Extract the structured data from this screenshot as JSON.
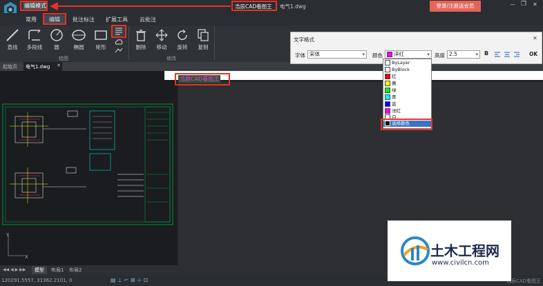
{
  "titlebar": {
    "mode_label": "编辑模式",
    "app_name": "浩辰CAD看图王",
    "doc_title": "电气1.dwg",
    "register_button": "登录/注册送会员",
    "minimize": "—",
    "restore": "❐",
    "close": "✕"
  },
  "menu_tabs": [
    "常用",
    "编辑",
    "批注标注",
    "扩展工具",
    "云批注"
  ],
  "ribbon": {
    "draw_tools": [
      "直线",
      "多段线",
      "圆",
      "椭圆",
      "矩形"
    ],
    "draw_group": "绘图",
    "modify_tools": [
      "删除",
      "移动",
      "旋转",
      "复制"
    ],
    "modify_group": "修改"
  },
  "doc_tabs": [
    "起始页",
    "电气1.dwg"
  ],
  "canvas_text": "浩辰CAD看图王",
  "text_format": {
    "title": "文字格式",
    "font_label": "字体",
    "font_value": "宋体",
    "color_label": "颜色",
    "color_value": "洋红",
    "height_label": "高度",
    "height_value": "2.5",
    "bold": "B",
    "ok": "OK"
  },
  "color_options": [
    {
      "label": "ByLayer",
      "color": "#ffffff"
    },
    {
      "label": "ByBlock",
      "color": "#ffffff"
    },
    {
      "label": "红",
      "color": "#ff0000"
    },
    {
      "label": "黄",
      "color": "#ffff00"
    },
    {
      "label": "绿",
      "color": "#00ff00"
    },
    {
      "label": "青",
      "color": "#00ffff"
    },
    {
      "label": "蓝",
      "color": "#0000ff"
    },
    {
      "label": "洋红",
      "color": "#ff00ff"
    },
    {
      "label": "白",
      "color": "#ffffff"
    },
    {
      "label": "选择颜色",
      "color": "#000000"
    }
  ],
  "layout_tabs": [
    "模型",
    "布局1",
    "布局2"
  ],
  "status": {
    "coords": "120291.5557, 31362.2101, 0",
    "app_name": "浩辰CAD看图王"
  },
  "watermark": {
    "site_name": "土木工程网",
    "url": "www.civilcn.com"
  },
  "colors": {
    "accent_red": "#e8302a",
    "register_bg": "#e3655a",
    "dropdown_highlight": "#3a72c4"
  }
}
